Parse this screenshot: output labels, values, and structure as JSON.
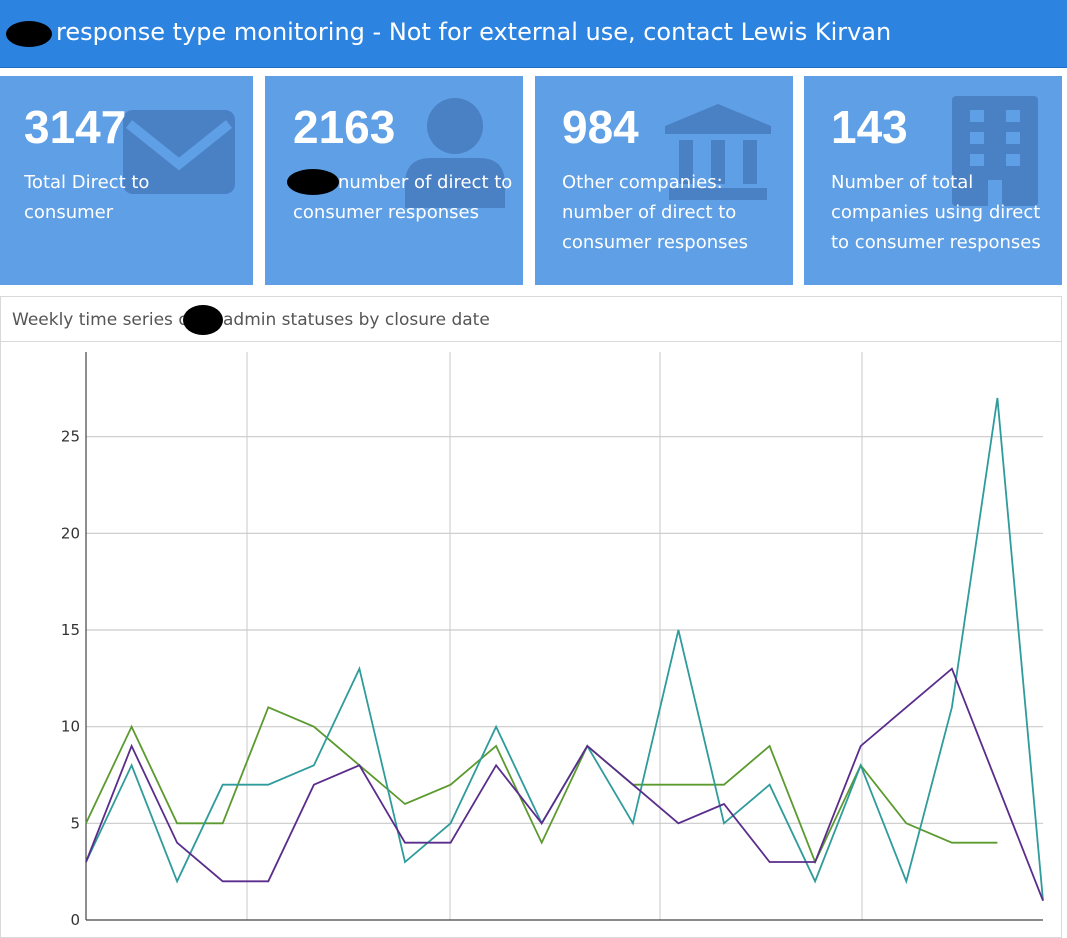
{
  "header": {
    "title": "response type monitoring - Not for external use, contact Lewis Kirvan"
  },
  "value_boxes": [
    {
      "value": "3147",
      "text": "Total Direct to consumer",
      "icon": "envelope-icon"
    },
    {
      "value": "2163",
      "text": "number of direct to consumer responses",
      "icon": "user-icon"
    },
    {
      "value": "984",
      "text": "Other companies: number of direct to consumer responses",
      "icon": "bank-icon"
    },
    {
      "value": "143",
      "text": "Number of total companies using direct to consumer responses",
      "icon": "building-icon"
    }
  ],
  "colors": {
    "header_bg": "#2d84e0",
    "box_bg": "#5f9fe6",
    "box_icon": "#4a80c4",
    "series_green": "#5b9a2f",
    "series_teal": "#2f9b9b",
    "series_purple": "#5a2d8c",
    "grid": "#c9c9c9"
  },
  "panel": {
    "title": "admin statuses by closure date",
    "title_prefix": "Weekly time series of"
  },
  "chart_data": {
    "type": "line",
    "title": "",
    "xlabel": "",
    "ylabel": "",
    "ylim": [
      0,
      30
    ],
    "yticks": [
      0,
      5,
      10,
      15,
      20,
      25
    ],
    "grid": true,
    "x": [
      0,
      1,
      2,
      3,
      4,
      5,
      6,
      7,
      8,
      9,
      10,
      11,
      12,
      13,
      14,
      15,
      16,
      17,
      18,
      19,
      20,
      21
    ],
    "series": [
      {
        "color": "#5b9a2f",
        "values": [
          5,
          10,
          5,
          5,
          11,
          10,
          8,
          6,
          7,
          9,
          4,
          9,
          7,
          7,
          7,
          9,
          3,
          8,
          5,
          4,
          4,
          null
        ]
      },
      {
        "color": "#2f9b9b",
        "values": [
          3,
          8,
          2,
          7,
          7,
          8,
          13,
          3,
          5,
          10,
          5,
          9,
          5,
          15,
          5,
          7,
          2,
          8,
          2,
          11,
          27,
          1
        ]
      },
      {
        "color": "#5a2d8c",
        "values": [
          3,
          9,
          4,
          2,
          2,
          7,
          8,
          4,
          4,
          8,
          5,
          9,
          7,
          5,
          6,
          3,
          3,
          9,
          11,
          13,
          null,
          1
        ]
      }
    ]
  }
}
